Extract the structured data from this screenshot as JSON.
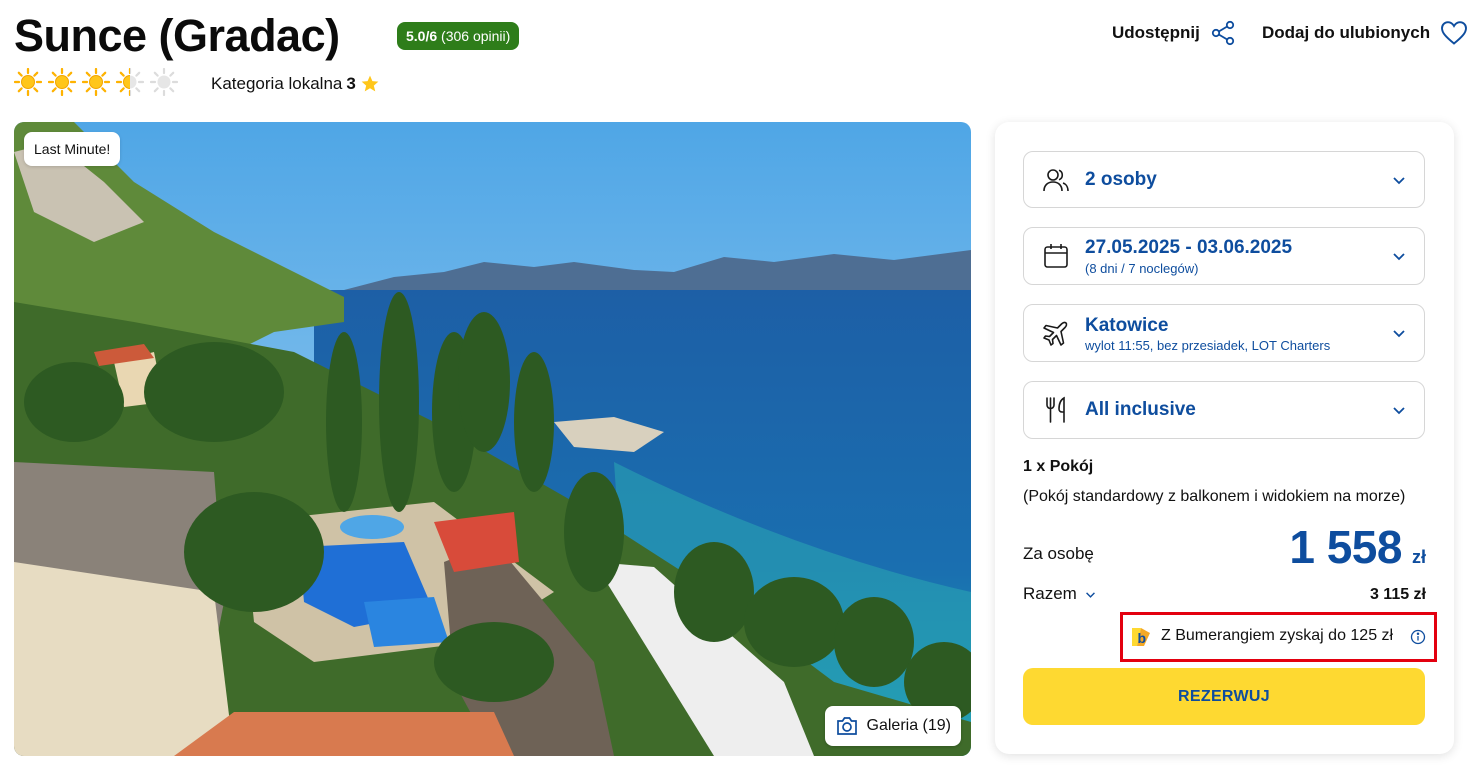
{
  "hotel": {
    "name": "Sunce (Gradac)",
    "rating_score": "5.0/6",
    "rating_opinions": "(306 opinii)",
    "sun_rating": 3.5,
    "sun_max": 5,
    "local_category_label": "Kategoria lokalna",
    "local_category_value": "3"
  },
  "actions": {
    "share_label": "Udostępnij",
    "favorite_label": "Dodaj do ulubionych"
  },
  "gallery": {
    "badge": "Last Minute!",
    "button_label": "Galeria (19)"
  },
  "booking": {
    "travelers": "2 osoby",
    "dates": "27.05.2025 - 03.06.2025",
    "duration": "(8 dni / 7 noclegów)",
    "departure_city": "Katowice",
    "flight_details": "wylot 11:55, bez przesiadek, LOT Charters",
    "board": "All inclusive",
    "room_count": "1 x Pokój",
    "room_description": "(Pokój standardowy z balkonem i widokiem na morze)",
    "per_person_label": "Za osobę",
    "price_per_person": "1 558",
    "currency": "zł",
    "total_label": "Razem",
    "total_value": "3 115 zł",
    "bumerang_text": "Z Bumerangiem zyskaj do 125 zł",
    "book_button": "REZERWUJ"
  },
  "colors": {
    "brand_blue": "#0e4d9e",
    "rating_green": "#2e7d1a",
    "cta_yellow": "#fed931",
    "highlight_red": "#e3000f"
  },
  "icons": [
    "sun-icon",
    "half-sun-icon",
    "star-icon",
    "share-icon",
    "heart-icon",
    "camera-icon",
    "people-icon",
    "calendar-icon",
    "plane-icon",
    "fork-knife-icon",
    "chevron-down-icon",
    "bumerang-logo-icon",
    "info-icon"
  ]
}
